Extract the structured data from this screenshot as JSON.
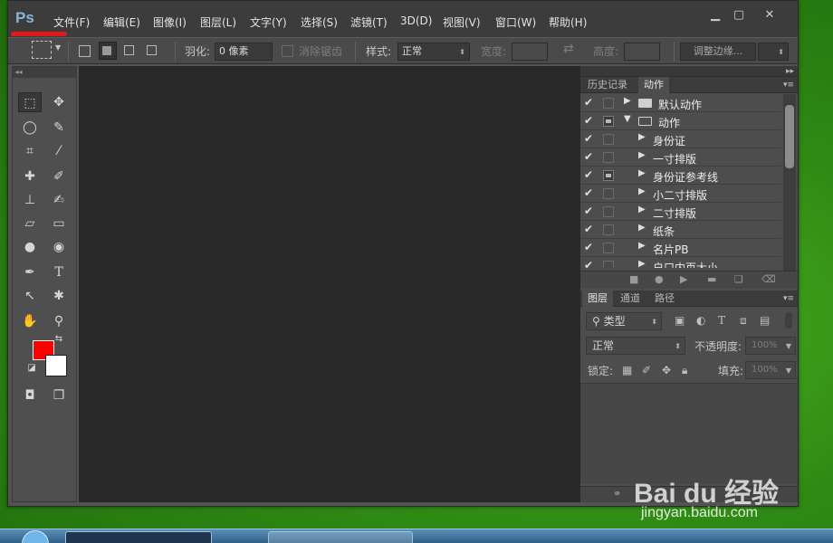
{
  "app": {
    "logo": "Ps"
  },
  "menu": [
    "文件(F)",
    "编辑(E)",
    "图像(I)",
    "图层(L)",
    "文字(Y)",
    "选择(S)",
    "滤镜(T)",
    "3D(D)",
    "视图(V)",
    "窗口(W)",
    "帮助(H)"
  ],
  "options": {
    "feather_label": "羽化:",
    "feather_value": "0 像素",
    "antialias_label": "消除锯齿",
    "style_label": "样式:",
    "style_value": "正常",
    "width_label": "宽度:",
    "height_label": "高度:",
    "refine_edge": "调整边缘..."
  },
  "actions_panel": {
    "tabs": [
      "历史记录",
      "动作"
    ],
    "rows": [
      {
        "label": "默认动作",
        "kind": "set-closed"
      },
      {
        "label": "动作",
        "kind": "set-open"
      },
      {
        "label": "身份证",
        "kind": "action"
      },
      {
        "label": "一寸排版",
        "kind": "action"
      },
      {
        "label": "身份证参考线",
        "kind": "action"
      },
      {
        "label": "小二寸排版",
        "kind": "action"
      },
      {
        "label": "二寸排版",
        "kind": "action"
      },
      {
        "label": "纸条",
        "kind": "action"
      },
      {
        "label": "名片PB",
        "kind": "action"
      },
      {
        "label": "户口内页大小",
        "kind": "action"
      }
    ]
  },
  "layers_panel": {
    "tabs": [
      "图层",
      "通道",
      "路径"
    ],
    "filter_kind": "类型",
    "blend_mode": "正常",
    "opacity_label": "不透明度:",
    "opacity_value": "100%",
    "lock_label": "锁定:",
    "fill_label": "填充:",
    "fill_value": "100%"
  },
  "colors": {
    "foreground": "#ff0000",
    "background": "#ffffff"
  },
  "watermark": {
    "brand": "Bai du 经验",
    "url": "jingyan.baidu.com"
  }
}
